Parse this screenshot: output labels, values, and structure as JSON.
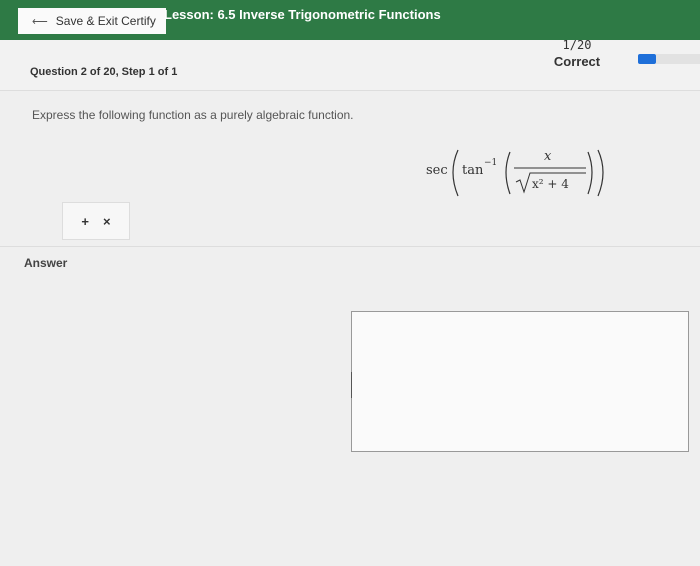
{
  "header": {
    "back_label": "Save & Exit Certify",
    "lesson_title": "Lesson: 6.5 Inverse Trigonometric Functions"
  },
  "question": {
    "label": "Question 2 of 20, Step 1 of 1",
    "score": "1/20",
    "status": "Correct",
    "progress_fraction": 0.05,
    "prompt": "Express the following function as a purely algebraic function."
  },
  "math": {
    "sec": "sec",
    "tan": "tan",
    "superscript": "−1",
    "numerator": "x",
    "radicand": "x² + 4"
  },
  "tools": {
    "plus": "+",
    "times": "×"
  },
  "answer": {
    "label": "Answer"
  },
  "colors": {
    "topbar": "#2e7a45",
    "progress": "#1e6fd9"
  }
}
